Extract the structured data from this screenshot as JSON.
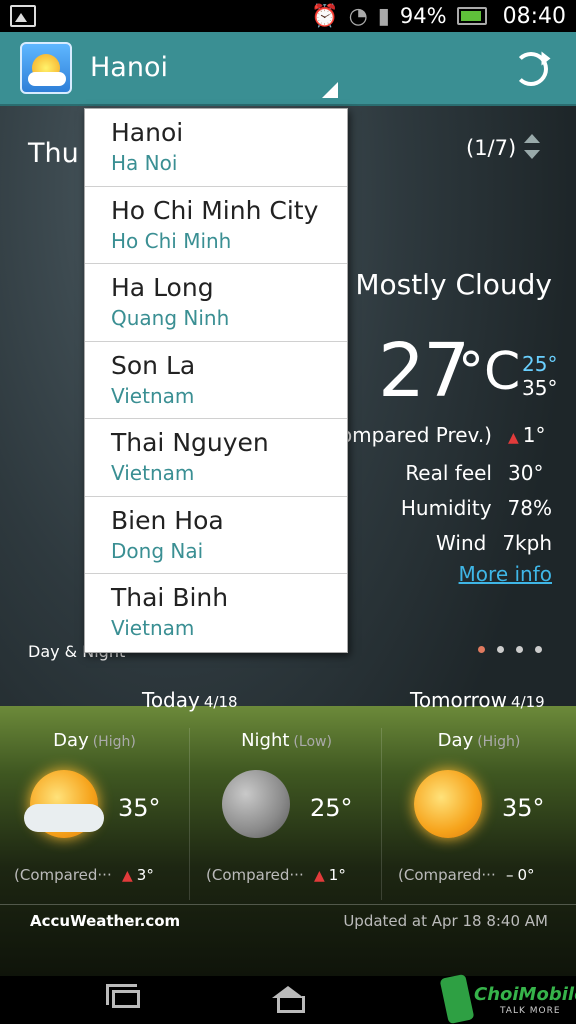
{
  "status_bar": {
    "battery": "94%",
    "time": "08:40"
  },
  "top_bar": {
    "city": "Hanoi"
  },
  "header": {
    "day_partial": "Thu",
    "page_indicator": "(1/7)"
  },
  "current": {
    "condition": "Mostly Cloudy",
    "temperature": "27",
    "unit": "°C",
    "low": "25°",
    "high": "35°",
    "details": [
      {
        "label": "ompared Prev.)",
        "value": "1°",
        "arrow": "up"
      },
      {
        "label": "Real feel",
        "value": "30°"
      },
      {
        "label": "Humidity",
        "value": "78%"
      },
      {
        "label": "Wind",
        "value": "7kph"
      }
    ],
    "more_info": "More info"
  },
  "section_label": "Day & Night",
  "forecast": {
    "today": {
      "label": "Today",
      "date": "4/18"
    },
    "tomorrow": {
      "label": "Tomorrow",
      "date": "4/19"
    },
    "columns": [
      {
        "period": "Day",
        "kind": "(High)",
        "temp": "35°",
        "compare": "(Compared···",
        "delta": "3°",
        "delta_icon": "up-arrow-icon"
      },
      {
        "period": "Night",
        "kind": "(Low)",
        "temp": "25°",
        "compare": "(Compared···",
        "delta": "1°",
        "delta_icon": "up-arrow-icon"
      },
      {
        "period": "Day",
        "kind": "(High)",
        "temp": "35°",
        "compare": "(Compared···",
        "delta": "0°",
        "delta_icon": "dash-icon"
      }
    ]
  },
  "footer": {
    "brand": "AccuWeather.com",
    "updated": "Updated at Apr 18 8:40 AM"
  },
  "dropdown": {
    "items": [
      {
        "city": "Hanoi",
        "region": "Ha Noi"
      },
      {
        "city": "Ho Chi Minh City",
        "region": "Ho Chi Minh"
      },
      {
        "city": "Ha Long",
        "region": "Quang Ninh"
      },
      {
        "city": "Son La",
        "region": "Vietnam"
      },
      {
        "city": "Thai Nguyen",
        "region": "Vietnam"
      },
      {
        "city": "Bien Hoa",
        "region": "Dong Nai"
      },
      {
        "city": "Thai Binh",
        "region": "Vietnam"
      }
    ]
  },
  "watermark": {
    "text": "ChoiMobile",
    "sub": "TALK MORE"
  },
  "colors": {
    "accent": "#3a8f93",
    "link": "#3fb6e6",
    "low_temp": "#6ad0ff",
    "up_arrow": "#e23b3b"
  }
}
